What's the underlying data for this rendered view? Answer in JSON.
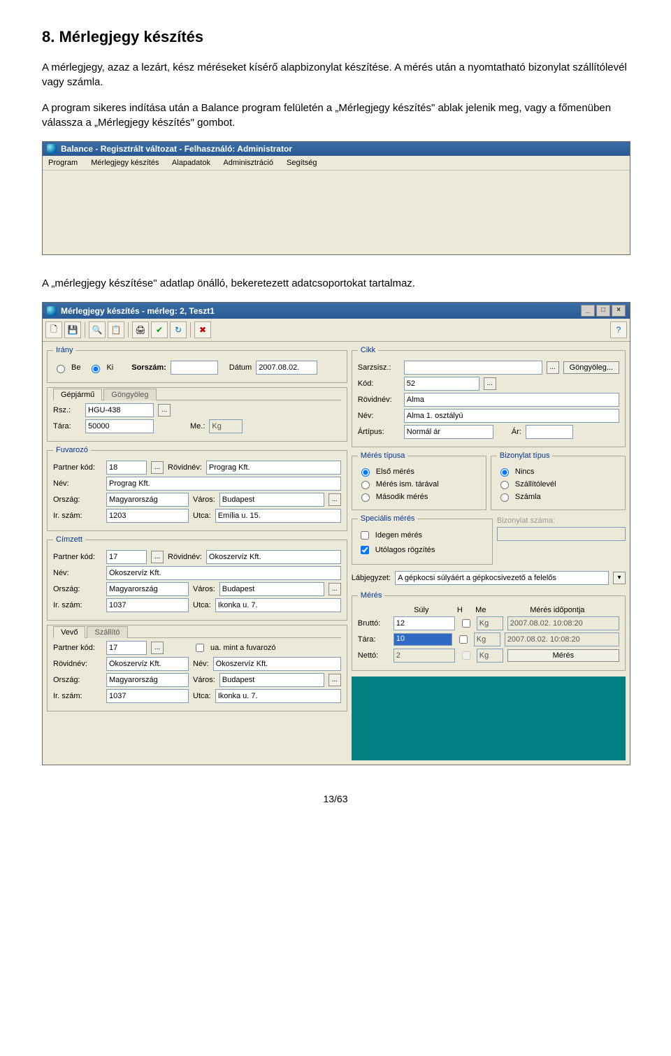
{
  "doc": {
    "heading": "8. Mérlegjegy készítés",
    "para1": "A mérlegjegy, azaz a lezárt, kész méréseket kísérő alapbizonylat készítése. A mérés után a nyomtatható bizonylat szállítólevél vagy számla.",
    "para2": "A program sikeres indítása után a Balance program felületén a „Mérlegjegy készítés\" ablak jelenik meg, vagy a főmenüben válassza a „Mérlegjegy készítés\" gombot.",
    "para3": "A „mérlegjegy készítése\" adatlap önálló, bekeretezett adatcsoportokat tartalmaz.",
    "pagenum": "13/63"
  },
  "win1": {
    "title": "Balance - Regisztrált változat - Felhasználó: Administrator",
    "menu": [
      "Program",
      "Mérlegjegy készítés",
      "Alapadatok",
      "Adminisztráció",
      "Segítség"
    ]
  },
  "win2": {
    "title": "Mérlegjegy készítés - mérleg: 2, Teszt1",
    "irany": {
      "legend": "Irány",
      "be": "Be",
      "ki": "Ki",
      "sorszam_lbl": "Sorszám:",
      "sorszam_val": "",
      "datum_lbl": "Dátum",
      "datum_val": "2007.08.02."
    },
    "gepjarmu": {
      "tab1": "Gépjármű",
      "tab2": "Göngyöleg",
      "rsz_lbl": "Rsz.:",
      "rsz_val": "HGU-438",
      "tara_lbl": "Tára:",
      "tara_val": "50000",
      "me_lbl": "Me.:",
      "me_val": "Kg"
    },
    "fuvarozo": {
      "legend": "Fuvarozó",
      "pk_lbl": "Partner kód:",
      "pk_val": "18",
      "rn_lbl": "Rövidnév:",
      "rn_val": "Prograg Kft.",
      "nev_lbl": "Név:",
      "nev_val": "Prograg Kft.",
      "orszag_lbl": "Ország:",
      "orszag_val": "Magyarország",
      "varos_lbl": "Város:",
      "varos_val": "Budapest",
      "ir_lbl": "Ir. szám:",
      "ir_val": "1203",
      "utca_lbl": "Utca:",
      "utca_val": "Emília u. 15."
    },
    "cimzett": {
      "legend": "Címzett",
      "pk_lbl": "Partner kód:",
      "pk_val": "17",
      "rn_lbl": "Rövidnév:",
      "rn_val": "Ökoszervíz Kft.",
      "nev_lbl": "Név:",
      "nev_val": "Ökoszervíz Kft.",
      "orszag_lbl": "Ország:",
      "orszag_val": "Magyarország",
      "varos_lbl": "Város:",
      "varos_val": "Budapest",
      "ir_lbl": "Ir. szám:",
      "ir_val": "1037",
      "utca_lbl": "Utca:",
      "utca_val": "Ikonka u. 7."
    },
    "vevo": {
      "tab1": "Vevő",
      "tab2": "Szállító",
      "pk_lbl": "Partner kód:",
      "pk_val": "17",
      "ua_lbl": "ua. mint a fuvarozó",
      "rn_lbl": "Rövidnév:",
      "rn_val": "Ökoszervíz Kft.",
      "nev_lbl": "Név:",
      "nev_val": "Ökoszervíz Kft.",
      "orszag_lbl": "Ország:",
      "orszag_val": "Magyarország",
      "varos_lbl": "Város:",
      "varos_val": "Budapest",
      "ir_lbl": "Ir. szám:",
      "ir_val": "1037",
      "utca_lbl": "Utca:",
      "utca_val": "Ikonka u. 7."
    },
    "cikk": {
      "legend": "Cikk",
      "sarzs_lbl": "Sarzsisz.:",
      "sarzs_val": "",
      "gongy_btn": "Göngyöleg...",
      "kod_lbl": "Kód:",
      "kod_val": "52",
      "rn_lbl": "Rövidnév:",
      "rn_val": "Alma",
      "nev_lbl": "Név:",
      "nev_val": "Alma 1. osztályú",
      "artipus_lbl": "Ártípus:",
      "artipus_val": "Normál ár",
      "ar_lbl": "Ár:",
      "ar_val": ""
    },
    "merestipus": {
      "legend": "Mérés típusa",
      "o1": "Első mérés",
      "o2": "Mérés ism. tárával",
      "o3": "Második mérés"
    },
    "bizonylat": {
      "legend": "Bizonylat típus",
      "o1": "Nincs",
      "o2": "Szállítólevél",
      "o3": "Számla"
    },
    "spec": {
      "legend": "Speciális mérés",
      "c1": "Idegen mérés",
      "c2": "Utólagos rögzítés",
      "bizszam_lbl": "Bizonylat száma:",
      "bizszam_val": ""
    },
    "labjegyzet": {
      "lbl": "Lábjegyzet:",
      "val": "A gépkocsi súlyáért a gépkocsivezető a felelős"
    },
    "meres": {
      "legend": "Mérés",
      "suly_h": "Súly",
      "h_h": "H",
      "me_h": "Me",
      "idop_h": "Mérés időpontja",
      "brutto_lbl": "Bruttó:",
      "brutto_val": "12",
      "brutto_me": "Kg",
      "brutto_t": "2007.08.02. 10:08:20",
      "tara_lbl": "Tára:",
      "tara_val": "10",
      "tara_me": "Kg",
      "tara_t": "2007.08.02. 10:08:20",
      "netto_lbl": "Nettó:",
      "netto_val": "2",
      "netto_me": "Kg",
      "meres_btn": "Mérés"
    }
  }
}
